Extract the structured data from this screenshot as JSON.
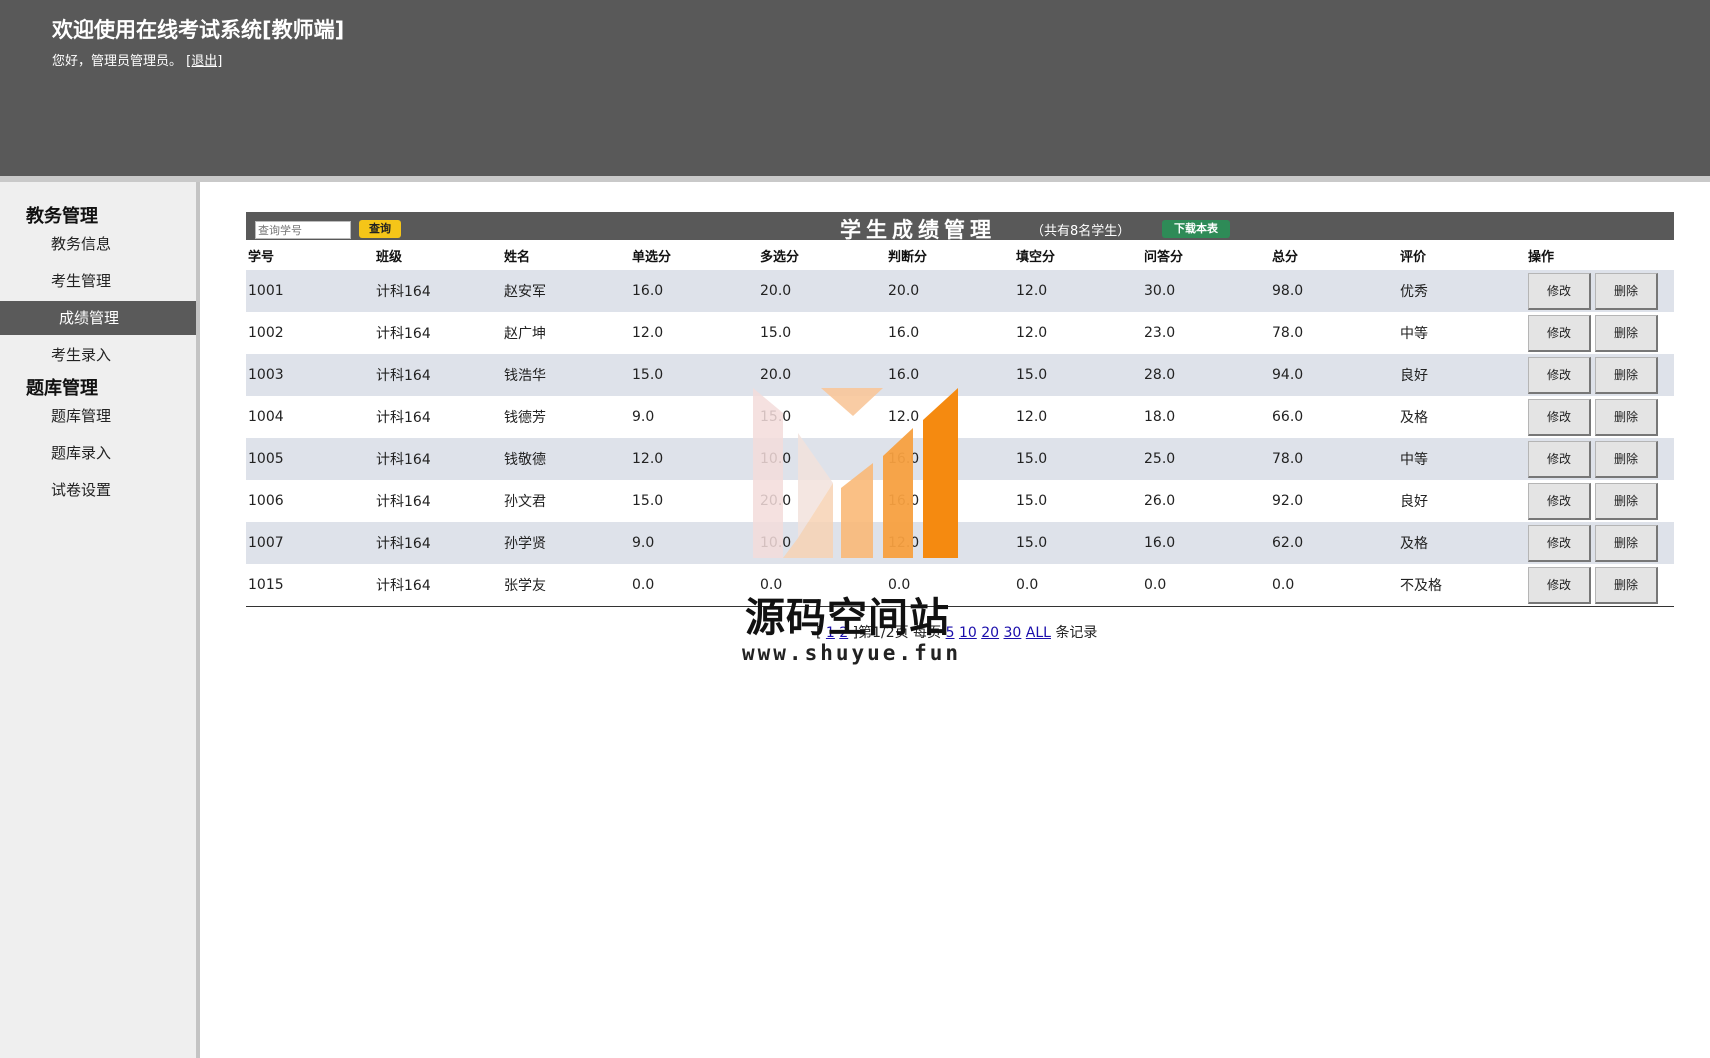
{
  "header": {
    "title": "欢迎使用在线考试系统[教师端]",
    "greeting": "您好，管理员管理员。",
    "logout_label": "[退出]"
  },
  "sidebar": {
    "group1": "教务管理",
    "group1_items": [
      "教务信息",
      "考生管理",
      "成绩管理",
      "考生录入"
    ],
    "group2": "题库管理",
    "group2_items": [
      "题库管理",
      "题库录入",
      "试卷设置"
    ],
    "active_item": "成绩管理"
  },
  "panel": {
    "search_placeholder": "查询学号",
    "search_button": "查询",
    "title": "学生成绩管理",
    "count_text": "（共有8名学生）",
    "download_button": "下载本表"
  },
  "table": {
    "headers": [
      "学号",
      "班级",
      "姓名",
      "单选分",
      "多选分",
      "判断分",
      "填空分",
      "问答分",
      "总分",
      "评价",
      "操作"
    ],
    "rows": [
      [
        "1001",
        "计科164",
        "赵安军",
        "16.0",
        "20.0",
        "20.0",
        "12.0",
        "30.0",
        "98.0",
        "优秀"
      ],
      [
        "1002",
        "计科164",
        "赵广坤",
        "12.0",
        "15.0",
        "16.0",
        "12.0",
        "23.0",
        "78.0",
        "中等"
      ],
      [
        "1003",
        "计科164",
        "钱浩华",
        "15.0",
        "20.0",
        "16.0",
        "15.0",
        "28.0",
        "94.0",
        "良好"
      ],
      [
        "1004",
        "计科164",
        "钱德芳",
        "9.0",
        "15.0",
        "12.0",
        "12.0",
        "18.0",
        "66.0",
        "及格"
      ],
      [
        "1005",
        "计科164",
        "钱敬德",
        "12.0",
        "10.0",
        "16.0",
        "15.0",
        "25.0",
        "78.0",
        "中等"
      ],
      [
        "1006",
        "计科164",
        "孙文君",
        "15.0",
        "20.0",
        "16.0",
        "15.0",
        "26.0",
        "92.0",
        "良好"
      ],
      [
        "1007",
        "计科164",
        "孙学贤",
        "9.0",
        "10.0",
        "12.0",
        "15.0",
        "16.0",
        "62.0",
        "及格"
      ],
      [
        "1015",
        "计科164",
        "张学友",
        "0.0",
        "0.0",
        "0.0",
        "0.0",
        "0.0",
        "0.0",
        "不及格"
      ]
    ],
    "edit_label": "修改",
    "delete_label": "删除"
  },
  "pager": {
    "open": "[",
    "page_links": [
      "1",
      "2"
    ],
    "close": "]",
    "page_info": "第1/2页",
    "per_page_label": "每页",
    "size_links": [
      "5",
      "10",
      "20",
      "30",
      "ALL"
    ],
    "suffix": "条记录"
  },
  "watermark": {
    "text": "源码空间站",
    "url": "www.shuyue.fun"
  }
}
